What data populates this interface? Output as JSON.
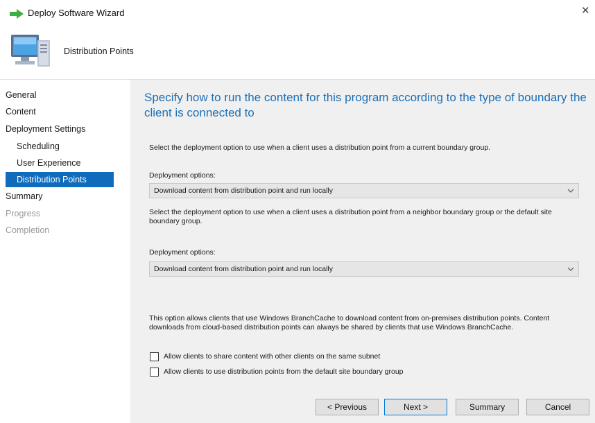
{
  "window": {
    "title": "Deploy Software Wizard",
    "close_icon": "close-icon"
  },
  "banner": {
    "title": "Distribution Points",
    "icon": "computer-icon"
  },
  "sidebar": {
    "items": [
      {
        "label": "General",
        "state": "normal"
      },
      {
        "label": "Content",
        "state": "normal"
      },
      {
        "label": "Deployment Settings",
        "state": "normal"
      },
      {
        "label": "Scheduling",
        "state": "normal"
      },
      {
        "label": "User Experience",
        "state": "normal"
      },
      {
        "label": "Distribution Points",
        "state": "active"
      },
      {
        "label": "Summary",
        "state": "normal"
      },
      {
        "label": "Progress",
        "state": "disabled"
      },
      {
        "label": "Completion",
        "state": "disabled"
      }
    ]
  },
  "main": {
    "heading": "Specify how to run the content for this program according to the type of boundary the client is connected to",
    "current_boundary_text": "Select the deployment option to use when a client uses a distribution point from a current boundary group.",
    "deployment_options_label_1": "Deployment options:",
    "deployment_option_1_value": "Download content from distribution point and run locally",
    "neighbor_boundary_text": "Select the deployment option to use when a client uses a distribution point from a neighbor boundary group or the default site boundary group.",
    "deployment_options_label_2": "Deployment options:",
    "deployment_option_2_value": "Download content from distribution point and run locally",
    "branchcache_text": "This option allows clients that use Windows BranchCache to download content from on-premises distribution points. Content downloads from cloud-based distribution points can always be shared by clients that use Windows BranchCache.",
    "checkbox_share_label": "Allow clients to share content with other clients on the same subnet",
    "checkbox_share_checked": false,
    "checkbox_default_site_label": "Allow clients to use distribution points from the default site boundary group",
    "checkbox_default_site_checked": false
  },
  "footer": {
    "previous_label": "< Previous",
    "next_label": "Next >",
    "summary_label": "Summary",
    "cancel_label": "Cancel"
  },
  "colors": {
    "accent": "#0f6cbd",
    "heading": "#1c6fb6",
    "content_bg": "#f0f0f0",
    "arrow_icon": "#3cb043"
  }
}
